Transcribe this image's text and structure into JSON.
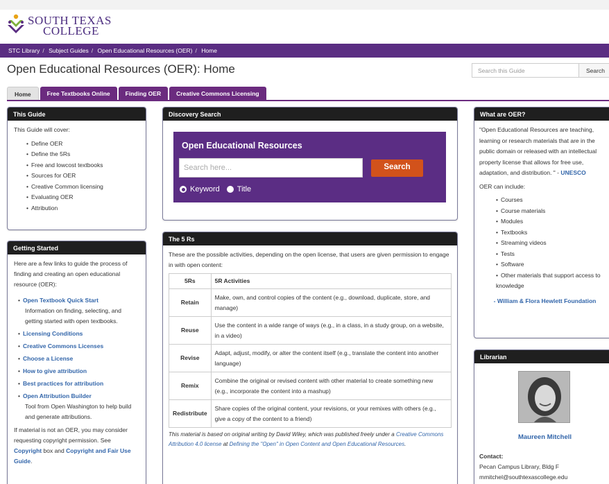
{
  "logo": {
    "line1": "South Texas",
    "line2": "College"
  },
  "breadcrumb": [
    "STC Library",
    "Subject Guides",
    "Open Educational Resources (OER)",
    "Home"
  ],
  "page_title": "Open Educational Resources (OER): Home",
  "guide_search": {
    "placeholder": "Search this Guide",
    "button": "Search"
  },
  "tabs": [
    "Home",
    "Free Textbooks Online",
    "Finding OER",
    "Creative Commons Licensing"
  ],
  "this_guide": {
    "heading": "This Guide",
    "intro": "This Guide will cover:",
    "items": [
      "Define OER",
      "Define the 5Rs",
      "Free and lowcost textbooks",
      "Sources for OER",
      "Creative Common licensing",
      "Evaluating OER",
      "Attribution"
    ]
  },
  "getting_started": {
    "heading": "Getting Started",
    "intro": "Here are a few links to guide the process of finding and creating an open educational resource (OER):",
    "links": [
      {
        "label": "Open Textbook Quick Start",
        "desc": "Information on finding, selecting, and getting started with open textbooks."
      },
      {
        "label": "Licensing Conditions",
        "desc": ""
      },
      {
        "label": "Creative Commons Licenses",
        "desc": ""
      },
      {
        "label": "Choose a License",
        "desc": ""
      },
      {
        "label": "How to give attribution",
        "desc": ""
      },
      {
        "label": "Best practices for attribution",
        "desc": ""
      },
      {
        "label": "Open Attribution Builder",
        "desc": "Tool from Open Washington to help build and generate attributions."
      }
    ],
    "outro_1": "If material is not an OER, you may consider requesting copyright permission. See ",
    "outro_link1": "Copyright",
    "outro_2": " box and ",
    "outro_link2": "Copyright and Fair Use Guide",
    "outro_3": "."
  },
  "discovery": {
    "heading": "Discovery Search",
    "title": "Open Educational Resources",
    "placeholder": "Search here...",
    "button": "Search",
    "radio_keyword": "Keyword",
    "radio_title": "Title"
  },
  "five_rs": {
    "heading": "The 5 Rs",
    "intro": "These are the possible activities, depending on the open license, that users are given permission to engage in with open content:",
    "col1": "5Rs",
    "col2": "5R Activities",
    "rows": [
      {
        "r": "Retain",
        "a": "Make, own, and control copies of the content (e.g., download, duplicate, store, and manage)"
      },
      {
        "r": "Reuse",
        "a": "Use the content in a wide range of ways (e.g., in a class, in a study group, on a website, in a video)"
      },
      {
        "r": "Revise",
        "a": "Adapt, adjust, modify, or alter the content itself (e.g., translate the content into another language)"
      },
      {
        "r": "Remix",
        "a": "Combine the original or revised content with other material to create something new (e.g., incorporate the content into a mashup)"
      },
      {
        "r": "Redistribute",
        "a": "Share copies of the original content, your revisions, or your remixes with others (e.g., give a copy of the content to a friend)"
      }
    ],
    "note_1": "This material is based on original writing by David Wiley, which was published freely under a ",
    "note_link1": "Creative Commons Attribution 4.0 license",
    "note_2": "  at  ",
    "note_link2": "Defining the \"Open\" in Open Content and Open Educational Resources",
    "note_3": "."
  },
  "what_oer": {
    "heading": "What are OER?",
    "quote": "\"Open Educational Resources are teaching, learning or research materials that are in the public domain or released with an intellectual property license that allows for free use, adaptation, and distribution. \" - ",
    "quote_src": "UNESCO",
    "can_include": "OER can include:",
    "items": [
      "Courses",
      "Course materials",
      "Modules",
      "Textbooks",
      "Streaming videos",
      "Tests",
      "Software",
      "Other materials that support access to knowledge"
    ],
    "source": "- William & Flora Hewlett Foundation"
  },
  "librarian": {
    "heading": "Librarian",
    "name": "Maureen Mitchell",
    "contact_label": "Contact:",
    "location": "Pecan Campus Library, Bldg F",
    "email": "mmitchel@southtexascollege.edu"
  },
  "colors": {
    "purple": "#5a2d82",
    "tab": "#6b2b7f",
    "search_button": "#d2521b",
    "link": "#3366aa"
  }
}
